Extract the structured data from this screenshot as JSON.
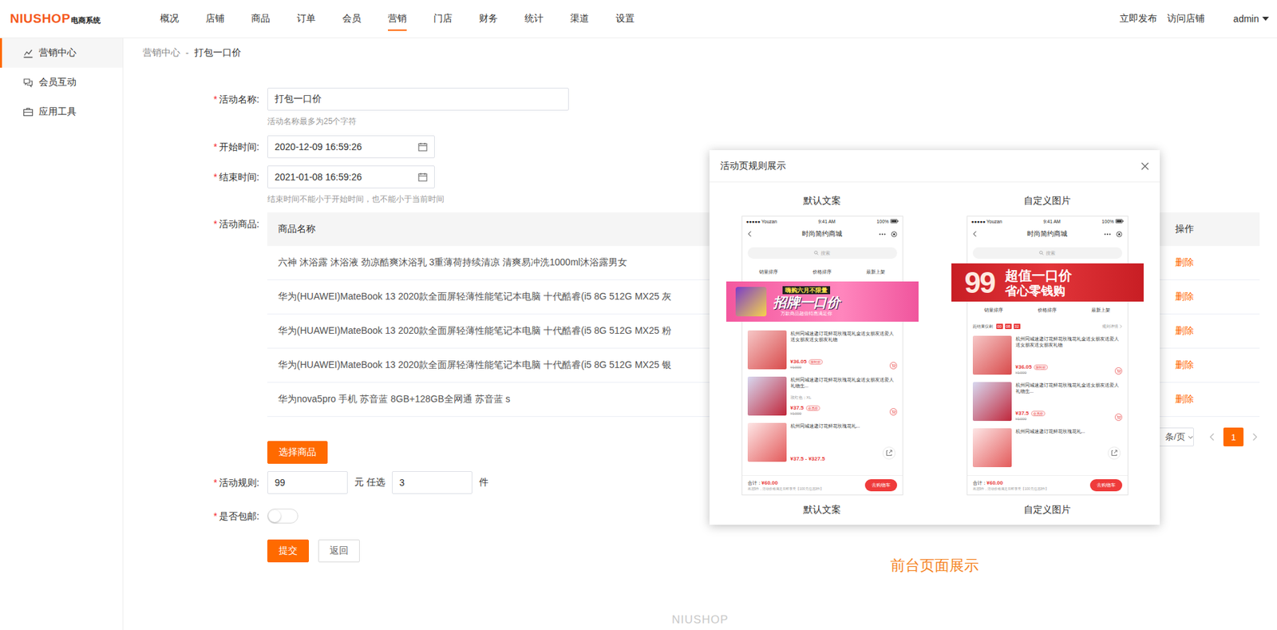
{
  "header": {
    "logo": {
      "brand": "NIUSHOP",
      "suffix": "电商系统"
    },
    "menu": [
      {
        "label": "概况",
        "selected": false
      },
      {
        "label": "店铺",
        "selected": false
      },
      {
        "label": "商品",
        "selected": false
      },
      {
        "label": "订单",
        "selected": false
      },
      {
        "label": "会员",
        "selected": false
      },
      {
        "label": "营销",
        "selected": true
      },
      {
        "label": "门店",
        "selected": false
      },
      {
        "label": "财务",
        "selected": false
      },
      {
        "label": "统计",
        "selected": false
      },
      {
        "label": "渠道",
        "selected": false
      },
      {
        "label": "设置",
        "selected": false
      }
    ],
    "links": [
      "立即发布",
      "访问店铺"
    ],
    "user": "admin"
  },
  "sidebar": {
    "items": [
      {
        "label": "营销中心",
        "selected": true
      },
      {
        "label": "会员互动",
        "selected": false
      },
      {
        "label": "应用工具",
        "selected": false
      }
    ]
  },
  "breadcrumb": {
    "items": [
      "营销中心",
      "打包一口价"
    ],
    "separator": "-"
  },
  "form": {
    "required_mark": "*",
    "name": {
      "label": "活动名称:",
      "value": "打包一口价",
      "hint": "活动名称最多为25个字符",
      "required": true
    },
    "start": {
      "label": "开始时间:",
      "value": "2020-12-09 16:59:26",
      "required": true
    },
    "end": {
      "label": "结束时间:",
      "value": "2021-01-08 16:59:26",
      "hint": "结束时间不能小于开始时间，也不能小于当前时间",
      "required": true
    },
    "goods": {
      "label": "活动商品:",
      "required": true,
      "columns": [
        "商品名称",
        "操作"
      ],
      "rows": [
        {
          "name": "六神 沐浴露 沐浴液 劲凉酷爽沐浴乳 3重薄荷持续清凉 清爽易冲洗1000ml沐浴露男女",
          "action": "删除"
        },
        {
          "name": "华为(HUAWEI)MateBook 13 2020款全面屏轻薄性能笔记本电脑 十代酷睿(i5 8G 512G MX25 灰",
          "action": "删除"
        },
        {
          "name": "华为(HUAWEI)MateBook 13 2020款全面屏轻薄性能笔记本电脑 十代酷睿(i5 8G 512G MX25 粉",
          "action": "删除"
        },
        {
          "name": "华为(HUAWEI)MateBook 13 2020款全面屏轻薄性能笔记本电脑 十代酷睿(i5 8G 512G MX25 银",
          "action": "删除"
        },
        {
          "name": "华为nova5pro 手机 苏音蓝 8GB+128GB全网通 苏音蓝 s",
          "action": "删除"
        }
      ],
      "pagination": {
        "page_size": "条/页",
        "pages": [
          {
            "label": "1",
            "selected": true
          }
        ]
      },
      "select_button": "选择商品"
    },
    "rule": {
      "label": "活动规则:",
      "required": true,
      "amount": "99",
      "unit_between": "元 任选",
      "count": "3",
      "unit_after": "件"
    },
    "free_shipping": {
      "label": "是否包邮:",
      "required": true,
      "on": false
    },
    "buttons": [
      {
        "label": "提交",
        "kind": "primary"
      },
      {
        "label": "返回",
        "kind": "plain"
      }
    ]
  },
  "modal": {
    "title": "活动页规则展示",
    "annotation": "前台页面展示",
    "previews": [
      {
        "kind": "default",
        "heading": "默认文案",
        "caption": "默认文案",
        "status": {
          "carrier": "●●●●● Youzan",
          "time": "9:41 AM",
          "battery": "100%"
        },
        "title": "时尚简约商城",
        "search": "搜索",
        "sorts": [
          "销量排序",
          "价格排序",
          "最新上架"
        ],
        "banner": {
          "top": "嗨购六月不限量",
          "main": "招牌一口价",
          "sub": "万款商品超值特惠满足你"
        },
        "products": [
          {
            "name": "杭州同城速递订花鲜花玫瑰花礼盒送女朋友送爱人送女朋友送女朋友礼物",
            "price": "¥36.05",
            "tag": "限时折",
            "old_price": "¥1000"
          },
          {
            "name": "杭州同城速递订花鲜花玫瑰花礼盒送女朋友送爱人礼物生...",
            "spec": "玫红色；XL",
            "price": "¥37.5",
            "tag": "会员价",
            "old_price": "¥1000"
          },
          {
            "name": "杭州同城速递订花鲜花玫瑰花礼...",
            "price": "¥37.5 - ¥327.5"
          }
        ],
        "footer": {
          "total_label": "合计：",
          "total": "¥60.00",
          "note": "再选5件，活动价格满足后即享受【100元任选3件】",
          "button": "去购物车"
        }
      },
      {
        "kind": "custom",
        "heading": "自定义图片",
        "caption": "自定义图片",
        "status": {
          "carrier": "●●●●● Youzan",
          "time": "9:41 AM",
          "battery": "100%"
        },
        "title": "时尚简约商城",
        "search": "搜索",
        "sorts": [
          "销量排序",
          "价格排序",
          "最新上架"
        ],
        "banner": {
          "number": "99",
          "main": "超值一口价",
          "sub": "省心零钱购"
        },
        "countdown": {
          "label": "距结束仅剩",
          "digits": [
            "00",
            "08",
            "32"
          ],
          "link": "规则详情"
        },
        "products": [
          {
            "name": "杭州同城速递订花鲜花玫瑰花礼盒送女朋友送爱人送女朋友送女朋友礼物",
            "price": "¥36.05",
            "tag": "限时折",
            "old_price": "¥1000"
          },
          {
            "name": "杭州同城速递订花鲜花玫瑰花礼盒送女朋友送爱人礼物生...",
            "price": "¥37.5",
            "tag": "会员价",
            "old_price": "¥1000"
          },
          {
            "name": "杭州同城速递订花鲜花玫瑰花礼..."
          }
        ],
        "footer": {
          "total_label": "合计：",
          "total": "¥60.00",
          "note": "再选5件，活动价格满足后即享受【100元任选3件】",
          "button": "去购物车"
        }
      }
    ]
  },
  "footer": "NIUSHOP"
}
